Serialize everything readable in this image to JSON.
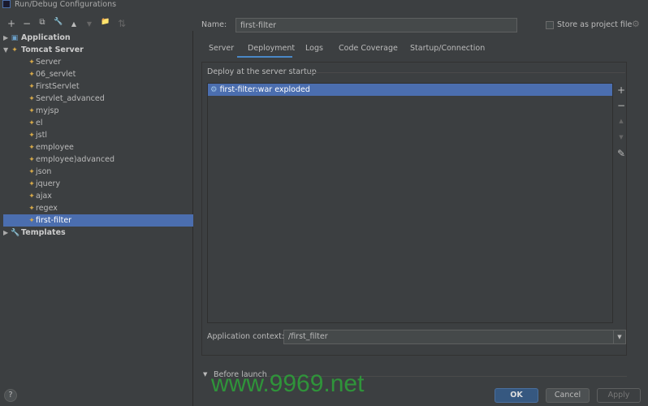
{
  "window": {
    "title": "Run/Debug Configurations"
  },
  "toolbar": {
    "add": "+",
    "remove": "−",
    "copy": "⧉",
    "edit": "🔧",
    "up": "▲",
    "down": "▼",
    "folder": "📁",
    "sort": "⇅"
  },
  "tree": {
    "application": "Application",
    "tomcat": "Tomcat Server",
    "items": [
      "Server",
      "06_servlet",
      "FirstServlet",
      "Servlet_advanced",
      "myjsp",
      "el",
      "jstl",
      "employee",
      "employee)advanced",
      "json",
      "jquery",
      "ajax",
      "regex",
      "first-filter"
    ],
    "selected": "first-filter",
    "templates": "Templates"
  },
  "name": {
    "label": "Name:",
    "value": "first-filter"
  },
  "store": {
    "label": "Store as project file",
    "checked": false
  },
  "tabs": [
    {
      "label": "Server"
    },
    {
      "label": "Deployment",
      "active": true
    },
    {
      "label": "Logs"
    },
    {
      "label": "Code Coverage"
    },
    {
      "label": "Startup/Connection"
    }
  ],
  "deploy": {
    "label": "Deploy at the server startup",
    "items": [
      "first-filter:war exploded"
    ]
  },
  "side_buttons": {
    "add": "+",
    "remove": "−",
    "up": "▲",
    "down": "▼",
    "edit": "✎"
  },
  "context": {
    "label": "Application context:",
    "value": "/first_filter"
  },
  "before_launch": {
    "label": "Before launch"
  },
  "buttons": {
    "help": "?",
    "ok": "OK",
    "cancel": "Cancel",
    "apply": "Apply"
  },
  "watermark": "www.9969.net",
  "colors": {
    "selection": "#4b6eaf",
    "ok": "#365880",
    "background": "#3c3f41"
  }
}
